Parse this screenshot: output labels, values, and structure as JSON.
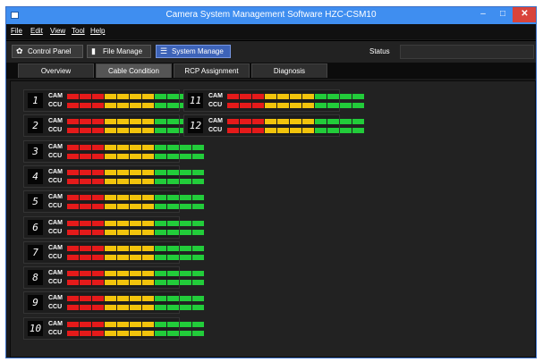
{
  "window": {
    "title": "Camera System Management Software HZC-CSM10"
  },
  "window_controls": {
    "minimize": "–",
    "maximize": "□",
    "close": "✕"
  },
  "menu": [
    "File",
    "Edit",
    "View",
    "Tool",
    "Help"
  ],
  "toolbar": {
    "buttons": [
      {
        "label": "Control Panel",
        "icon": "gear-icon",
        "active": false
      },
      {
        "label": "File Manage",
        "icon": "document-icon",
        "active": false
      },
      {
        "label": "System Manage",
        "icon": "list-icon",
        "active": true
      }
    ],
    "status_label": "Status",
    "status_value": ""
  },
  "tabs": [
    {
      "label": "Overview",
      "active": false
    },
    {
      "label": "Cable Condition",
      "active": true
    },
    {
      "label": "RCP Assignment",
      "active": false
    },
    {
      "label": "Diagnosis",
      "active": false
    }
  ],
  "meter_labels": {
    "cam": "CAM",
    "ccu": "CCU"
  },
  "meter_colors": [
    "red",
    "red",
    "red",
    "yellow",
    "yellow",
    "yellow",
    "yellow",
    "green",
    "green",
    "green",
    "green"
  ],
  "colors": {
    "red": "#e51a1a",
    "yellow": "#f2c40c",
    "green": "#22cc3a",
    "accent": "#3f8ef0"
  },
  "cameras": [
    {
      "number": "1",
      "cam_level": 11,
      "ccu_level": 11
    },
    {
      "number": "2",
      "cam_level": 11,
      "ccu_level": 11
    },
    {
      "number": "3",
      "cam_level": 11,
      "ccu_level": 11
    },
    {
      "number": "4",
      "cam_level": 11,
      "ccu_level": 11
    },
    {
      "number": "5",
      "cam_level": 11,
      "ccu_level": 11
    },
    {
      "number": "6",
      "cam_level": 11,
      "ccu_level": 11
    },
    {
      "number": "7",
      "cam_level": 11,
      "ccu_level": 11
    },
    {
      "number": "8",
      "cam_level": 11,
      "ccu_level": 11
    },
    {
      "number": "9",
      "cam_level": 11,
      "ccu_level": 11
    },
    {
      "number": "10",
      "cam_level": 11,
      "ccu_level": 11
    },
    {
      "number": "11",
      "cam_level": 11,
      "ccu_level": 11
    },
    {
      "number": "12",
      "cam_level": 11,
      "ccu_level": 11
    }
  ]
}
